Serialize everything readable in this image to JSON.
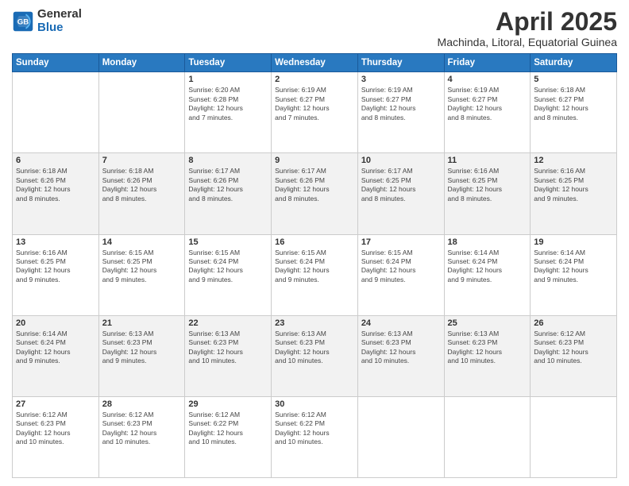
{
  "logo": {
    "line1": "General",
    "line2": "Blue"
  },
  "title": "April 2025",
  "subtitle": "Machinda, Litoral, Equatorial Guinea",
  "days_header": [
    "Sunday",
    "Monday",
    "Tuesday",
    "Wednesday",
    "Thursday",
    "Friday",
    "Saturday"
  ],
  "weeks": [
    [
      {
        "num": "",
        "info": ""
      },
      {
        "num": "",
        "info": ""
      },
      {
        "num": "1",
        "info": "Sunrise: 6:20 AM\nSunset: 6:28 PM\nDaylight: 12 hours\nand 7 minutes."
      },
      {
        "num": "2",
        "info": "Sunrise: 6:19 AM\nSunset: 6:27 PM\nDaylight: 12 hours\nand 7 minutes."
      },
      {
        "num": "3",
        "info": "Sunrise: 6:19 AM\nSunset: 6:27 PM\nDaylight: 12 hours\nand 8 minutes."
      },
      {
        "num": "4",
        "info": "Sunrise: 6:19 AM\nSunset: 6:27 PM\nDaylight: 12 hours\nand 8 minutes."
      },
      {
        "num": "5",
        "info": "Sunrise: 6:18 AM\nSunset: 6:27 PM\nDaylight: 12 hours\nand 8 minutes."
      }
    ],
    [
      {
        "num": "6",
        "info": "Sunrise: 6:18 AM\nSunset: 6:26 PM\nDaylight: 12 hours\nand 8 minutes."
      },
      {
        "num": "7",
        "info": "Sunrise: 6:18 AM\nSunset: 6:26 PM\nDaylight: 12 hours\nand 8 minutes."
      },
      {
        "num": "8",
        "info": "Sunrise: 6:17 AM\nSunset: 6:26 PM\nDaylight: 12 hours\nand 8 minutes."
      },
      {
        "num": "9",
        "info": "Sunrise: 6:17 AM\nSunset: 6:26 PM\nDaylight: 12 hours\nand 8 minutes."
      },
      {
        "num": "10",
        "info": "Sunrise: 6:17 AM\nSunset: 6:25 PM\nDaylight: 12 hours\nand 8 minutes."
      },
      {
        "num": "11",
        "info": "Sunrise: 6:16 AM\nSunset: 6:25 PM\nDaylight: 12 hours\nand 8 minutes."
      },
      {
        "num": "12",
        "info": "Sunrise: 6:16 AM\nSunset: 6:25 PM\nDaylight: 12 hours\nand 9 minutes."
      }
    ],
    [
      {
        "num": "13",
        "info": "Sunrise: 6:16 AM\nSunset: 6:25 PM\nDaylight: 12 hours\nand 9 minutes."
      },
      {
        "num": "14",
        "info": "Sunrise: 6:15 AM\nSunset: 6:25 PM\nDaylight: 12 hours\nand 9 minutes."
      },
      {
        "num": "15",
        "info": "Sunrise: 6:15 AM\nSunset: 6:24 PM\nDaylight: 12 hours\nand 9 minutes."
      },
      {
        "num": "16",
        "info": "Sunrise: 6:15 AM\nSunset: 6:24 PM\nDaylight: 12 hours\nand 9 minutes."
      },
      {
        "num": "17",
        "info": "Sunrise: 6:15 AM\nSunset: 6:24 PM\nDaylight: 12 hours\nand 9 minutes."
      },
      {
        "num": "18",
        "info": "Sunrise: 6:14 AM\nSunset: 6:24 PM\nDaylight: 12 hours\nand 9 minutes."
      },
      {
        "num": "19",
        "info": "Sunrise: 6:14 AM\nSunset: 6:24 PM\nDaylight: 12 hours\nand 9 minutes."
      }
    ],
    [
      {
        "num": "20",
        "info": "Sunrise: 6:14 AM\nSunset: 6:24 PM\nDaylight: 12 hours\nand 9 minutes."
      },
      {
        "num": "21",
        "info": "Sunrise: 6:13 AM\nSunset: 6:23 PM\nDaylight: 12 hours\nand 9 minutes."
      },
      {
        "num": "22",
        "info": "Sunrise: 6:13 AM\nSunset: 6:23 PM\nDaylight: 12 hours\nand 10 minutes."
      },
      {
        "num": "23",
        "info": "Sunrise: 6:13 AM\nSunset: 6:23 PM\nDaylight: 12 hours\nand 10 minutes."
      },
      {
        "num": "24",
        "info": "Sunrise: 6:13 AM\nSunset: 6:23 PM\nDaylight: 12 hours\nand 10 minutes."
      },
      {
        "num": "25",
        "info": "Sunrise: 6:13 AM\nSunset: 6:23 PM\nDaylight: 12 hours\nand 10 minutes."
      },
      {
        "num": "26",
        "info": "Sunrise: 6:12 AM\nSunset: 6:23 PM\nDaylight: 12 hours\nand 10 minutes."
      }
    ],
    [
      {
        "num": "27",
        "info": "Sunrise: 6:12 AM\nSunset: 6:23 PM\nDaylight: 12 hours\nand 10 minutes."
      },
      {
        "num": "28",
        "info": "Sunrise: 6:12 AM\nSunset: 6:23 PM\nDaylight: 12 hours\nand 10 minutes."
      },
      {
        "num": "29",
        "info": "Sunrise: 6:12 AM\nSunset: 6:22 PM\nDaylight: 12 hours\nand 10 minutes."
      },
      {
        "num": "30",
        "info": "Sunrise: 6:12 AM\nSunset: 6:22 PM\nDaylight: 12 hours\nand 10 minutes."
      },
      {
        "num": "",
        "info": ""
      },
      {
        "num": "",
        "info": ""
      },
      {
        "num": "",
        "info": ""
      }
    ]
  ]
}
